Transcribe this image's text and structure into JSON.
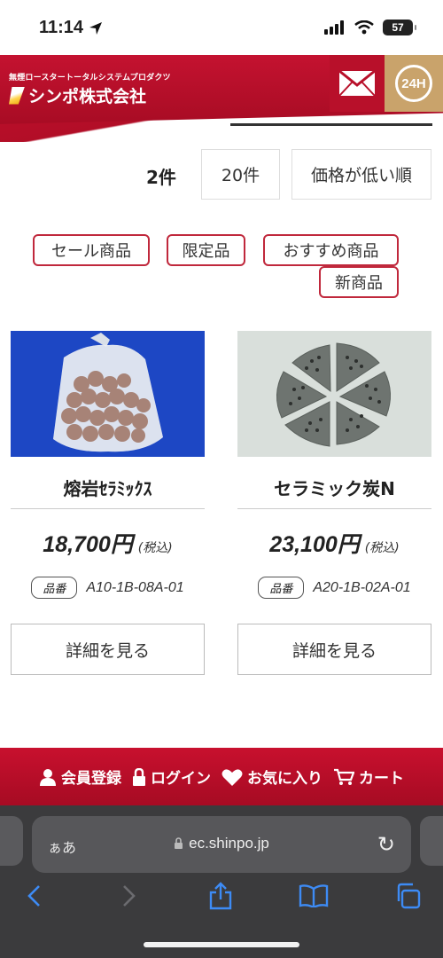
{
  "status": {
    "time": "11:14",
    "battery": "57"
  },
  "header": {
    "logo_sub": "無煙ロースタートータルシステムプロダクツ",
    "logo_name": "シンポ株式会社",
    "support_badge": "24H"
  },
  "listing": {
    "count": "2件",
    "per_page": "20件",
    "sort_order": "価格が低い順"
  },
  "tags": [
    "セール商品",
    "限定品",
    "おすすめ商品",
    "新商品"
  ],
  "products": [
    {
      "name": "熔岩ｾﾗﾐｯｸｽ",
      "price": "18,700円",
      "tax_note": "(税込)",
      "code_label": "品番",
      "code": "A10-1B-08A-01",
      "detail_label": "詳細を見る"
    },
    {
      "name": "セラミック炭N",
      "price": "23,100円",
      "tax_note": "(税込)",
      "code_label": "品番",
      "code": "A20-1B-02A-01",
      "detail_label": "詳細を見る"
    }
  ],
  "member_bar": {
    "register": "会員登録",
    "login": "ログイン",
    "favorites": "お気に入り",
    "cart": "カート"
  },
  "browser": {
    "aa_label": "ぁあ",
    "url": "ec.shinpo.jp"
  },
  "colors": {
    "brand_red": "#c8102e",
    "gold": "#c9a36b"
  }
}
